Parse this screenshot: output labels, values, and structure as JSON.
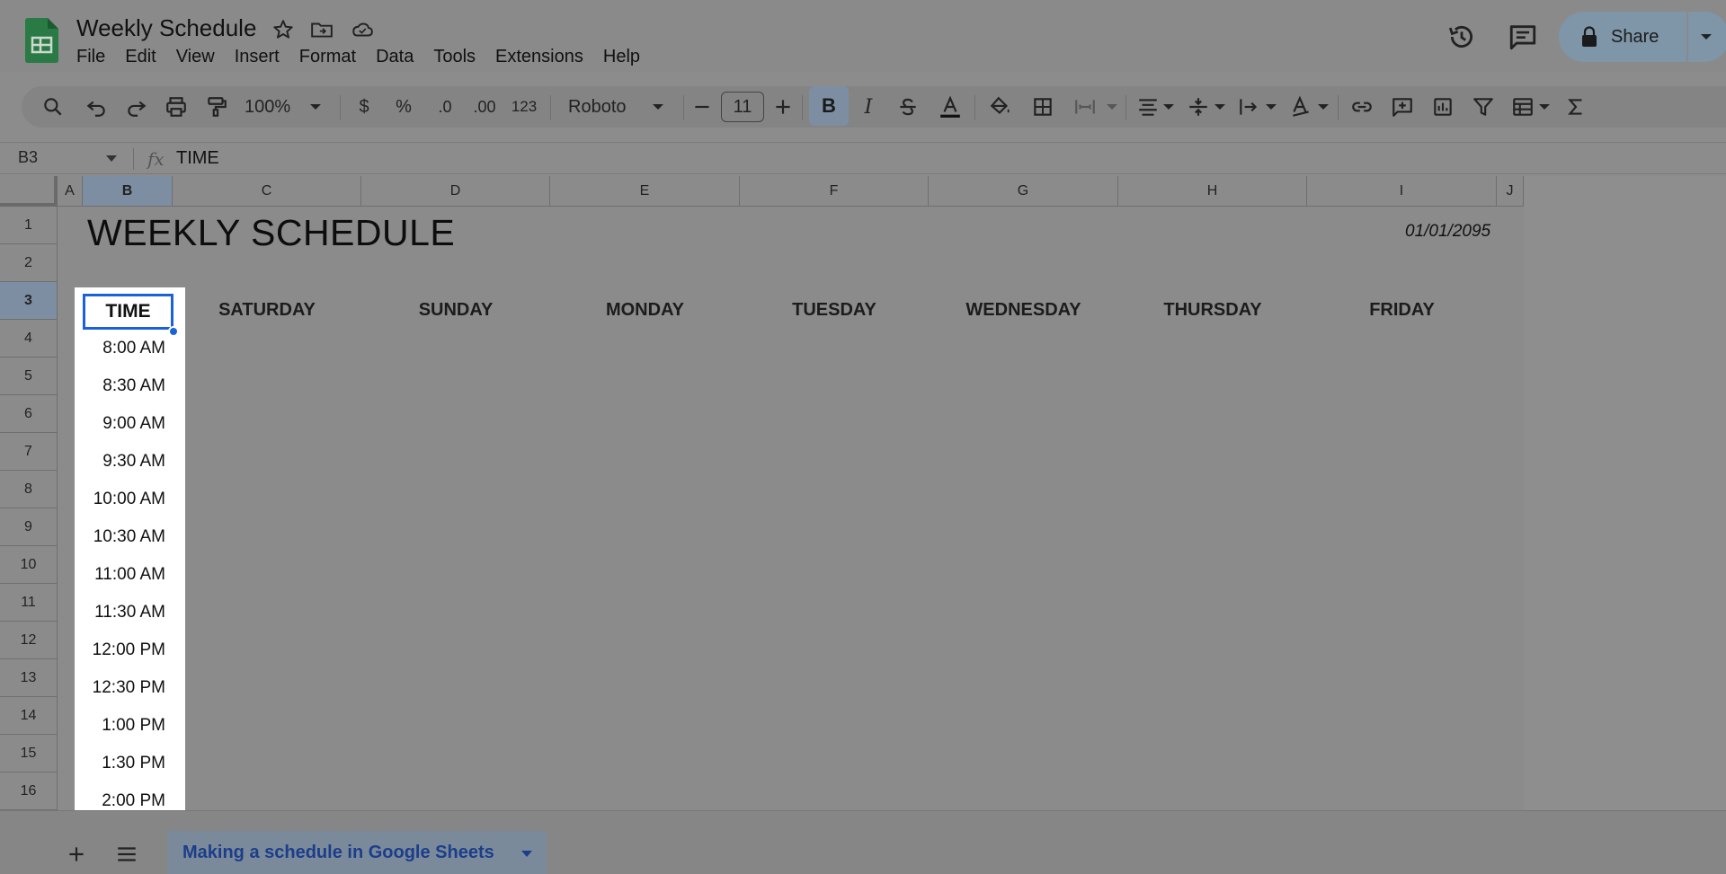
{
  "app": {
    "doc_title": "Weekly Schedule",
    "menu": [
      "File",
      "Edit",
      "View",
      "Insert",
      "Format",
      "Data",
      "Tools",
      "Extensions",
      "Help"
    ],
    "share_label": "Share"
  },
  "toolbar": {
    "zoom": "100%",
    "currency": "$",
    "percent": "%",
    "dec_decrease": ".0",
    "dec_increase": ".00",
    "number_format": "123",
    "font": "Roboto",
    "font_size": "11",
    "bold": "B",
    "italic": "I"
  },
  "formula_bar": {
    "cell_ref": "B3",
    "fx": "fx",
    "value": "TIME"
  },
  "columns": [
    "A",
    "B",
    "C",
    "D",
    "E",
    "F",
    "G",
    "H",
    "I",
    "J"
  ],
  "rows": [
    "1",
    "2",
    "3",
    "4",
    "5",
    "6",
    "7",
    "8",
    "9",
    "10",
    "11",
    "12",
    "13",
    "14",
    "15",
    "16"
  ],
  "sheet": {
    "title": "WEEKLY SCHEDULE",
    "date": "01/01/2095",
    "time_header": "TIME",
    "days": [
      "SATURDAY",
      "SUNDAY",
      "MONDAY",
      "TUESDAY",
      "WEDNESDAY",
      "THURSDAY",
      "FRIDAY"
    ],
    "times": [
      "8:00 AM",
      "8:30 AM",
      "9:00 AM",
      "9:30 AM",
      "10:00 AM",
      "10:30 AM",
      "11:00 AM",
      "11:30 AM",
      "12:00 PM",
      "12:30 PM",
      "1:00 PM",
      "1:30 PM",
      "2:00 PM"
    ]
  },
  "tabs": {
    "active": "Making a schedule in Google Sheets"
  },
  "colors": {
    "selection": "#1a62d8",
    "sheet_icon": "#1e8e3e"
  }
}
